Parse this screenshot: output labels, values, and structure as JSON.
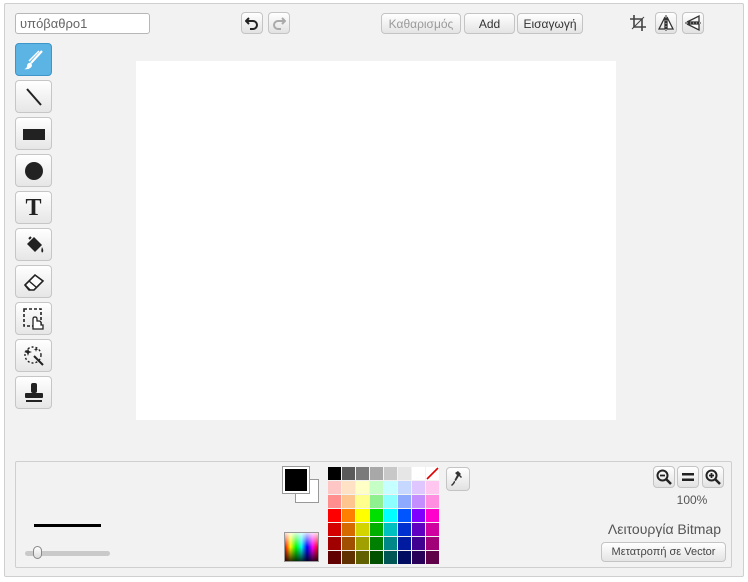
{
  "costume_name": {
    "value": "υπόβαθρο1"
  },
  "toolbar": {
    "clear_label": "Καθαρισμός",
    "add_label": "Add",
    "import_label": "Εισαγωγή"
  },
  "icons": {
    "undo": "undo-icon",
    "redo": "redo-icon",
    "crop": "crop-icon",
    "flip_horizontal": "flip-horizontal-icon",
    "flip_vertical": "flip-vertical-icon",
    "set_center": "set-center-icon"
  },
  "tools": [
    "brush",
    "line",
    "rectangle",
    "ellipse",
    "text",
    "fill",
    "eraser",
    "select",
    "select-and-duplicate",
    "stamp"
  ],
  "selected_tool": "brush",
  "text_tool_glyph": "T",
  "colors": {
    "selected_tool_bg": "#5cb4e4",
    "primary": "#000000",
    "secondary": "#ffffff",
    "canvas": "#ffffff",
    "panel": "#f2f2f2"
  },
  "palette": [
    "#000000",
    "#5a5a5a",
    "#7a7a7a",
    "#a8a8a8",
    "#c8c8c8",
    "#e6e6e6",
    "#ffffff",
    "transparent",
    "#ffc6c6",
    "#ffe2c6",
    "#ffffc6",
    "#c6ffc6",
    "#c6ffff",
    "#c6d8ff",
    "#e0c6ff",
    "#ffc6f0",
    "#ff8e8e",
    "#ffc58e",
    "#ffff8e",
    "#8ef08e",
    "#8effff",
    "#8eaaff",
    "#c58eff",
    "#ff8ee0",
    "#ff0000",
    "#ff8000",
    "#ffff00",
    "#00e000",
    "#00ffff",
    "#0055ff",
    "#8000ff",
    "#ff00cc",
    "#d40000",
    "#d46a00",
    "#d4d400",
    "#00b000",
    "#00c0c0",
    "#0030d0",
    "#6000c0",
    "#d000a0",
    "#a00000",
    "#a05000",
    "#a0a000",
    "#008000",
    "#008888",
    "#001aa0",
    "#400090",
    "#a00078",
    "#600000",
    "#603000",
    "#606000",
    "#005000",
    "#005555",
    "#000c60",
    "#280058",
    "#600048"
  ],
  "zoom": {
    "level": "100%"
  },
  "mode": {
    "label": "Λειτουργία Bitmap",
    "convert_label": "Μετατροπή σε Vector"
  }
}
